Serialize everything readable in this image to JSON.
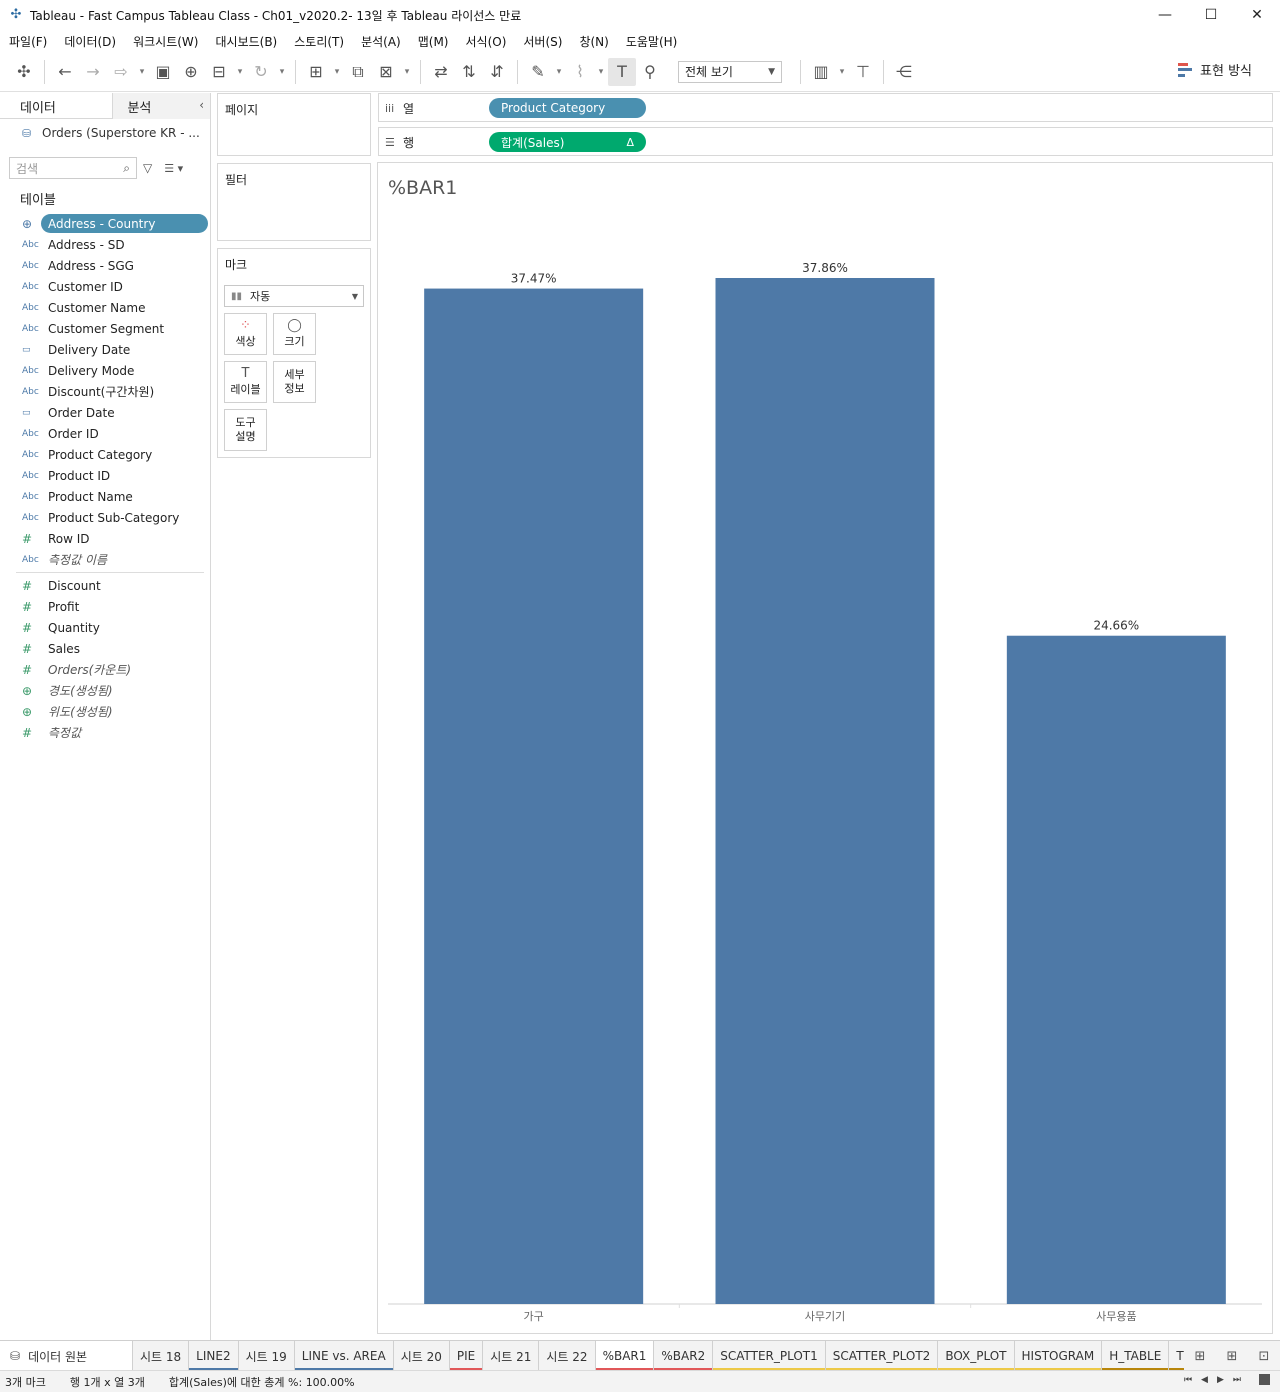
{
  "window": {
    "title": "Tableau - Fast Campus Tableau Class - Ch01_v2020.2- 13일 후 Tableau 라이선스 만료",
    "minimize": "—",
    "maximize": "☐",
    "close": "✕"
  },
  "menu": [
    "파일(F)",
    "데이터(D)",
    "워크시트(W)",
    "대시보드(B)",
    "스토리(T)",
    "분석(A)",
    "맵(M)",
    "서식(O)",
    "서버(S)",
    "창(N)",
    "도움말(H)"
  ],
  "toolbar": {
    "view_select": "전체 보기",
    "show_me": "표현 방식",
    "show_me_colors": [
      "#e0554b",
      "#4e79a7",
      "#4e79a7"
    ]
  },
  "data_pane": {
    "tab_data": "데이터",
    "tab_analysis": "분석",
    "datasource": "Orders (Superstore KR - ...",
    "search_placeholder": "검색",
    "tables_label": "테이블",
    "dimensions": [
      {
        "icon": "geo",
        "name": "Address - Country",
        "selected": true
      },
      {
        "icon": "abc",
        "name": "Address - SD"
      },
      {
        "icon": "abc",
        "name": "Address - SGG"
      },
      {
        "icon": "abc",
        "name": "Customer ID"
      },
      {
        "icon": "abc",
        "name": "Customer Name"
      },
      {
        "icon": "abc",
        "name": "Customer Segment"
      },
      {
        "icon": "date",
        "name": "Delivery Date"
      },
      {
        "icon": "abc",
        "name": "Delivery Mode"
      },
      {
        "icon": "abc",
        "name": "Discount(구간차원)"
      },
      {
        "icon": "date",
        "name": "Order Date"
      },
      {
        "icon": "abc",
        "name": "Order ID"
      },
      {
        "icon": "abc",
        "name": "Product Category"
      },
      {
        "icon": "abc",
        "name": "Product ID"
      },
      {
        "icon": "abc",
        "name": "Product Name"
      },
      {
        "icon": "abc",
        "name": "Product Sub-Category"
      },
      {
        "icon": "num",
        "name": "Row ID"
      },
      {
        "icon": "abc",
        "name": "측정값 이름",
        "italic": true
      }
    ],
    "measures": [
      {
        "icon": "num",
        "name": "Discount"
      },
      {
        "icon": "num",
        "name": "Profit"
      },
      {
        "icon": "num",
        "name": "Quantity"
      },
      {
        "icon": "num",
        "name": "Sales"
      },
      {
        "icon": "num",
        "name": "Orders(카운트)",
        "italic": true
      },
      {
        "icon": "geo",
        "name": "경도(생성됨)",
        "italic": true
      },
      {
        "icon": "geo",
        "name": "위도(생성됨)",
        "italic": true
      },
      {
        "icon": "num",
        "name": "측정값",
        "italic": true
      }
    ]
  },
  "cards": {
    "pages": "페이지",
    "filters": "필터",
    "marks": "마크",
    "marks_type": "자동",
    "buttons": [
      {
        "icon": "color-icon",
        "label": "색상"
      },
      {
        "icon": "size-icon",
        "label": "크기"
      },
      {
        "icon": "label-icon",
        "label": "레이블"
      },
      {
        "icon": "detail-icon",
        "label": "세부\n정보"
      },
      {
        "icon": "tooltip-icon",
        "label": "도구\n설명"
      }
    ]
  },
  "shelves": {
    "columns_label": "열",
    "rows_label": "행",
    "columns_pill": "Product Category",
    "rows_pill": "합계(Sales)",
    "rows_pill_delta": "Δ"
  },
  "sheet_title": "%BAR1",
  "chart_data": {
    "type": "bar",
    "title": "%BAR1",
    "categories": [
      "가구",
      "사무기기",
      "사무용품"
    ],
    "values": [
      37.47,
      37.86,
      24.66
    ],
    "value_labels": [
      "37.47%",
      "37.86%",
      "24.66%"
    ],
    "ylim": [
      0,
      37.86
    ],
    "bar_color": "#4e79a7",
    "grid": false
  },
  "tabs": [
    {
      "label": "데이터 원본",
      "type": "datasource"
    },
    {
      "label": "시트 18"
    },
    {
      "label": "LINE2",
      "color": "#4e79a7"
    },
    {
      "label": "시트 19"
    },
    {
      "label": "LINE vs. AREA",
      "color": "#4e79a7"
    },
    {
      "label": "시트 20"
    },
    {
      "label": "PIE",
      "color": "#e15759"
    },
    {
      "label": "시트 21"
    },
    {
      "label": "시트 22"
    },
    {
      "label": "%BAR1",
      "color": "#e15759",
      "active": true
    },
    {
      "label": "%BAR2",
      "color": "#e15759"
    },
    {
      "label": "SCATTER_PLOT1",
      "color": "#edc948"
    },
    {
      "label": "SCATTER_PLOT2",
      "color": "#edc948"
    },
    {
      "label": "BOX_PLOT",
      "color": "#edc948"
    },
    {
      "label": "HISTOGRAM",
      "color": "#edc948"
    },
    {
      "label": "H_TABLE",
      "color": "#b8860b"
    },
    {
      "label": "TREEMAP",
      "color": "#b8860b"
    }
  ],
  "status": {
    "marks": "3개 마크",
    "rows_cols": "행 1개 x 열 3개",
    "summary": "합계(Sales)에 대한 총계 %: 100.00%"
  }
}
